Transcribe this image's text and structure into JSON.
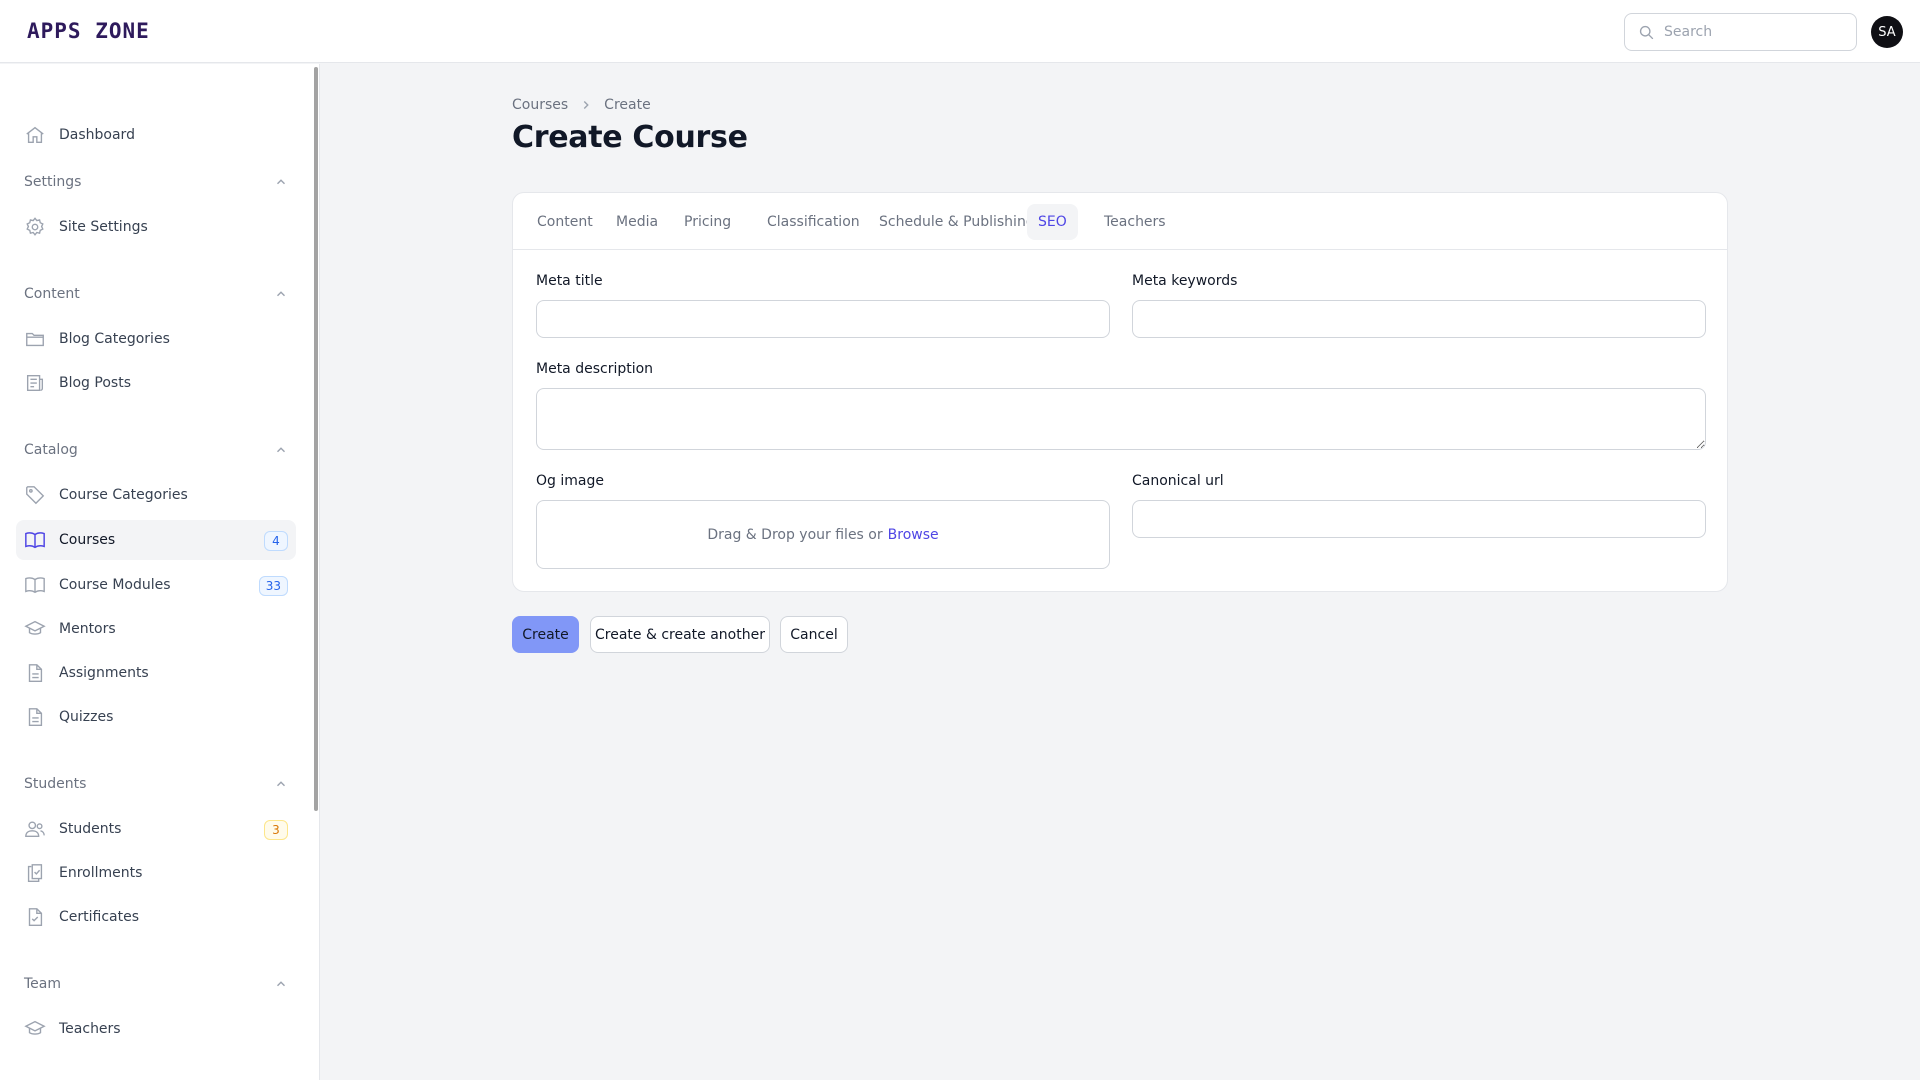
{
  "app": {
    "logo": "APPS ZONE"
  },
  "header": {
    "search_placeholder": "Search",
    "avatar_initials": "SA"
  },
  "sidebar": {
    "dashboard": "Dashboard",
    "groups": {
      "settings": "Settings",
      "content": "Content",
      "catalog": "Catalog",
      "students": "Students",
      "team": "Team"
    },
    "items": {
      "site_settings": "Site Settings",
      "blog_categories": "Blog Categories",
      "blog_posts": "Blog Posts",
      "course_categories": "Course Categories",
      "courses": "Courses",
      "courses_badge": "4",
      "course_modules": "Course Modules",
      "course_modules_badge": "33",
      "mentors": "Mentors",
      "assignments": "Assignments",
      "quizzes": "Quizzes",
      "students": "Students",
      "students_badge": "3",
      "enrollments": "Enrollments",
      "certificates": "Certificates",
      "teachers": "Teachers"
    },
    "active_item": "Courses"
  },
  "breadcrumb": {
    "parent": "Courses",
    "current": "Create"
  },
  "page_title": "Create Course",
  "tabs": [
    "Content",
    "Media",
    "Pricing",
    "Classification",
    "Schedule & Publishing",
    "SEO",
    "Teachers"
  ],
  "active_tab": "SEO",
  "form": {
    "meta_title_label": "Meta title",
    "meta_title_value": "",
    "meta_keywords_label": "Meta keywords",
    "meta_keywords_value": "",
    "meta_description_label": "Meta description",
    "meta_description_value": "",
    "og_image_label": "Og image",
    "dropzone_text": "Drag & Drop your files or",
    "dropzone_browse": "Browse",
    "canonical_url_label": "Canonical url",
    "canonical_url_value": ""
  },
  "actions": {
    "create": "Create",
    "create_another": "Create & create another",
    "cancel": "Cancel"
  },
  "colors": {
    "accent": "#4f46e5",
    "primary_button": "#8197f7",
    "logo": "#2e1a5c",
    "background": "#f3f4f6"
  }
}
